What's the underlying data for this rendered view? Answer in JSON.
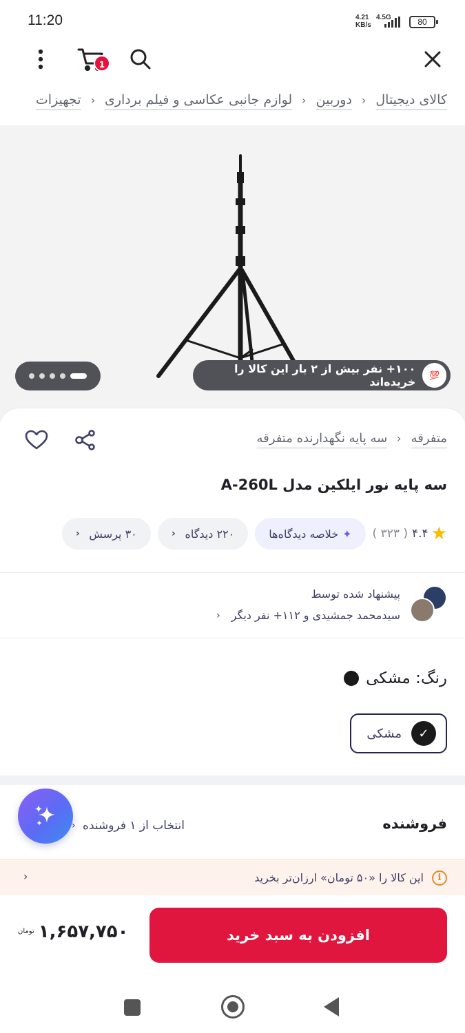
{
  "status_bar": {
    "time": "11:20",
    "net_speed": "4.21",
    "net_unit": "KB/s",
    "network_type": "4.5G",
    "battery": "80"
  },
  "top_nav": {
    "cart_badge": "1",
    "icons": [
      "more-vertical-icon",
      "cart-icon",
      "search-icon",
      "close-icon"
    ]
  },
  "breadcrumb": [
    "کالای دیجیتال",
    "دوربین",
    "لوازم جانبی عکاسی و فیلم برداری",
    "تجهیزات"
  ],
  "gallery": {
    "buyers_badge": "۱۰۰+ نفر بیش از ۲ بار این کالا را خریده‌اند",
    "buyers_icon_text": "💯",
    "dots_count": 5,
    "active_dot": 0
  },
  "product": {
    "sub_breadcrumb": [
      "متفرقه",
      "سه پایه نگهدارنده متفرقه"
    ],
    "title": "سه پایه نور ایلکین مدل A-260L",
    "rating": "۴.۴",
    "rating_count": "( ۳۲۳ )",
    "ai_summary_label": "خلاصه دیدگاه‌ها",
    "reviews_label": "۲۲۰ دیدگاه",
    "questions_label": "۳۰ پرسش"
  },
  "recommended": {
    "title": "پیشنهاد شده توسط",
    "subtitle": "سیدمحمد جمشیدی و ۱۱۲+ نفر دیگر"
  },
  "color": {
    "label": "رنگ: مشکی",
    "swatch_color": "#1a1a1a",
    "options": [
      {
        "name": "مشکی",
        "selected": true
      }
    ]
  },
  "seller": {
    "title": "فروشنده",
    "select_label": "انتخاب از ۱ فروشنده"
  },
  "promo": {
    "text": "این کالا را «۵۰ تومان» ارزان‌تر بخرید"
  },
  "bottom_bar": {
    "add_to_cart": "افزودن به سبد خرید",
    "price": "۱,۶۵۷,۷۵۰",
    "currency": "تومان"
  },
  "colors": {
    "accent": "#e0163f",
    "text": "#23254e"
  }
}
